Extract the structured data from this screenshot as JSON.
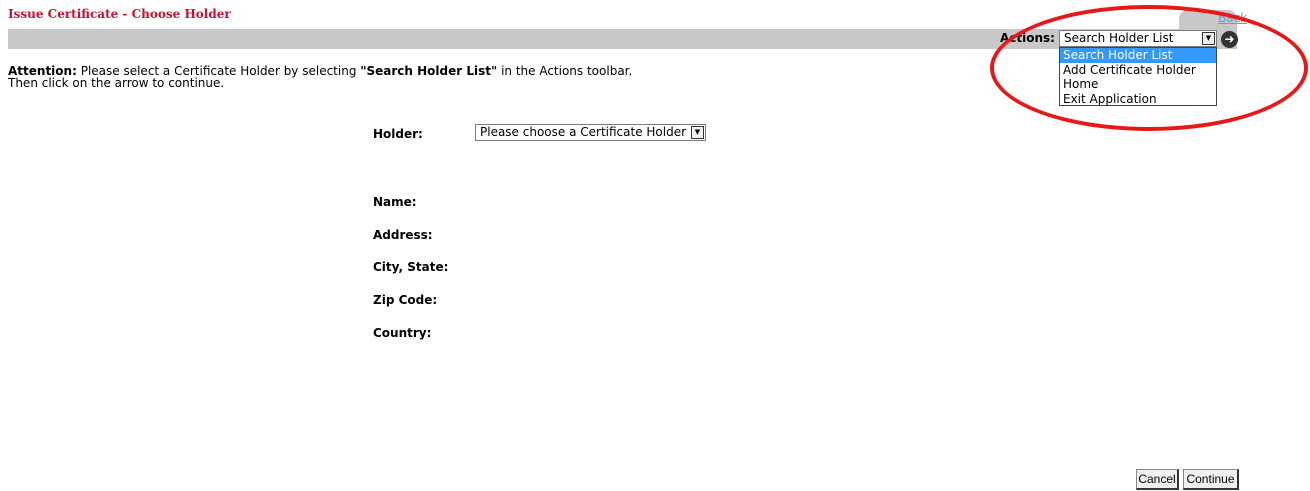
{
  "page": {
    "title": "Issue Certificate - Choose Holder",
    "back_link": "Back"
  },
  "toolbar": {
    "actions_label": "Actions:",
    "selected_action": "Search Holder List",
    "go_icon": "arrow-right-circle-icon",
    "dropdown_options": [
      "Search Holder List",
      "Add Certificate Holder",
      "Home",
      "Exit Application"
    ]
  },
  "attention": {
    "label": "Attention:",
    "text_before": " Please select a Certificate Holder by selecting ",
    "highlight": "\"Search Holder List\"",
    "text_after": " in the Actions toolbar.",
    "line2": "Then click on the arrow to continue."
  },
  "form": {
    "holder_label": "Holder:",
    "holder_value": "Please choose a Certificate Holder",
    "name_label": "Name:",
    "address_label": "Address:",
    "city_state_label": "City, State:",
    "zip_label": "Zip Code:",
    "country_label": "Country:"
  },
  "buttons": {
    "cancel": "Cancel",
    "continue": "Continue"
  },
  "colors": {
    "title": "#c8102e",
    "toolbar": "#c8c8c8",
    "highlight_option": "#3399ff",
    "annotation_circle": "#e81818"
  }
}
